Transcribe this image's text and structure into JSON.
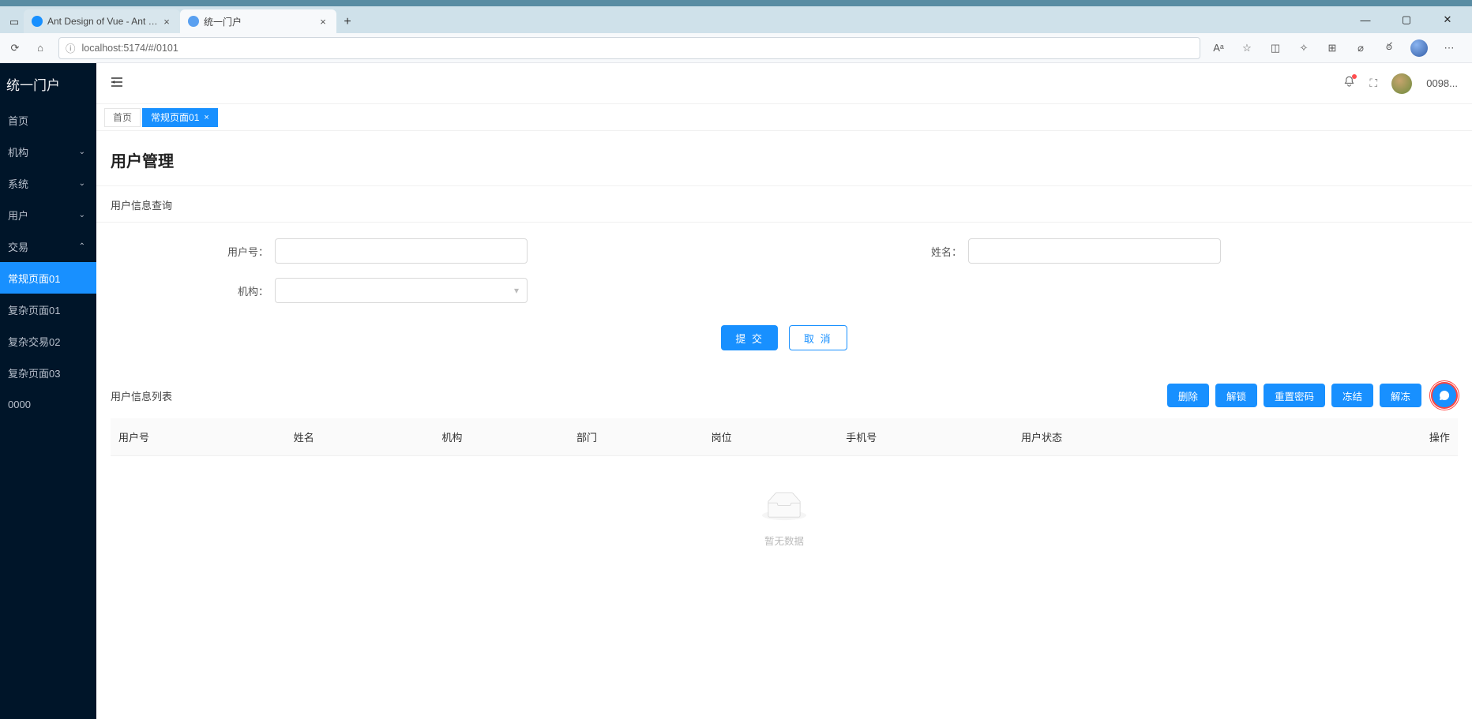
{
  "browser": {
    "tabs": [
      {
        "title": "Ant Design of Vue - Ant Design"
      },
      {
        "title": "统一门户"
      }
    ],
    "url": "localhost:5174/#/0101",
    "read_aloud": "Aᵃ"
  },
  "app": {
    "logo": "统一门户",
    "menu": [
      {
        "label": "首页",
        "expandable": false
      },
      {
        "label": "机构",
        "expandable": true,
        "expanded": false
      },
      {
        "label": "系统",
        "expandable": true,
        "expanded": false
      },
      {
        "label": "用户",
        "expandable": true,
        "expanded": false
      },
      {
        "label": "交易",
        "expandable": true,
        "expanded": true
      },
      {
        "label": "常规页面01",
        "expandable": false,
        "selected": true
      },
      {
        "label": "复杂页面01",
        "expandable": false
      },
      {
        "label": "复杂交易02",
        "expandable": false
      },
      {
        "label": "复杂页面03",
        "expandable": false
      },
      {
        "label": "0000",
        "expandable": false
      }
    ],
    "header": {
      "username": "0098..."
    },
    "page_tabs": {
      "home": "首页",
      "active": "常规页面01"
    }
  },
  "page": {
    "title": "用户管理",
    "query_section": "用户信息查询",
    "list_section": "用户信息列表",
    "form": {
      "user_no_label": "用户号：",
      "name_label": "姓名：",
      "org_label": "机构：",
      "submit": "提 交",
      "cancel": "取 消"
    },
    "toolbar": {
      "delete": "删除",
      "unlock": "解锁",
      "reset_pw": "重置密码",
      "freeze": "冻结",
      "unfreeze": "解冻"
    },
    "columns": [
      "用户号",
      "姓名",
      "机构",
      "部门",
      "岗位",
      "手机号",
      "用户状态",
      "操作"
    ],
    "col_widths": [
      "13%",
      "11%",
      "10%",
      "10%",
      "10%",
      "13%",
      "22%",
      "11%"
    ],
    "empty_text": "暂无数据"
  }
}
